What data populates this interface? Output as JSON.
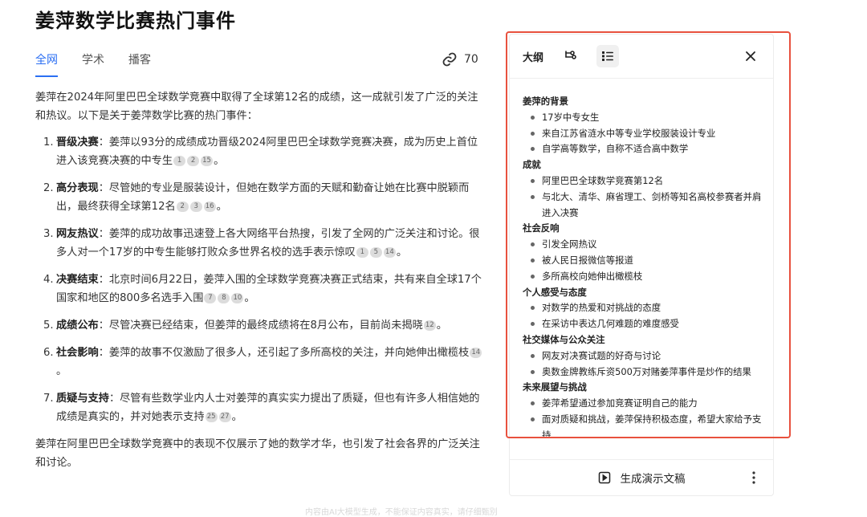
{
  "page": {
    "title": "姜萍数学比赛热门事件"
  },
  "tabs": [
    {
      "label": "全网",
      "active": true
    },
    {
      "label": "学术",
      "active": false
    },
    {
      "label": "播客",
      "active": false
    }
  ],
  "link_count": "70",
  "intro": "姜萍在2024年阿里巴巴全球数学竞赛中取得了全球第12名的成绩，这一成就引发了广泛的关注和热议。以下是关于姜萍数学比赛的热门事件：",
  "events": [
    {
      "num": "1.",
      "title": "晋级决赛",
      "text": "：姜萍以93分的成绩成功晋级2024阿里巴巴全球数学竞赛决赛，成为历史上首位进入该竞赛决赛的中专生",
      "cites": [
        "1",
        "2",
        "15"
      ],
      "end": "。"
    },
    {
      "num": "2.",
      "title": "高分表现",
      "text": "：尽管她的专业是服装设计，但她在数学方面的天赋和勤奋让她在比赛中脱颖而出，最终获得全球第12名",
      "cites": [
        "2",
        "3",
        "16"
      ],
      "end": "。"
    },
    {
      "num": "3.",
      "title": "网友热议",
      "text": "：姜萍的成功故事迅速登上各大网络平台热搜，引发了全网的广泛关注和讨论。很多人对一个17岁的中专生能够打败众多世界名校的选手表示惊叹",
      "cites": [
        "1",
        "5",
        "14"
      ],
      "end": "。"
    },
    {
      "num": "4.",
      "title": "决赛结束",
      "text": "：北京时间6月22日，姜萍入围的全球数学竞赛决赛正式结束，共有来自全球17个国家和地区的800多名选手入围",
      "cites": [
        "7",
        "8",
        "10"
      ],
      "end": "。"
    },
    {
      "num": "5.",
      "title": "成绩公布",
      "text": "：尽管决赛已经结束，但姜萍的最终成绩将在8月公布，目前尚未揭晓",
      "cites": [
        "12"
      ],
      "end": "。"
    },
    {
      "num": "6.",
      "title": "社会影响",
      "text": "：姜萍的故事不仅激励了很多人，还引起了多所高校的关注，并向她伸出橄榄枝",
      "cites": [
        "14"
      ],
      "end": "。"
    },
    {
      "num": "7.",
      "title": "质疑与支持",
      "text": "：尽管有些数学业内人士对姜萍的真实实力提出了质疑，但也有许多人相信她的成绩是真实的，并对她表示支持",
      "cites": [
        "25",
        "27"
      ],
      "end": "。"
    }
  ],
  "conclusion": "姜萍在阿里巴巴全球数学竞赛中的表现不仅展示了她的数学才华，也引发了社会各界的广泛关注和讨论。",
  "outline": {
    "header_label": "大纲",
    "sections": [
      {
        "title": "姜萍的背景",
        "items": [
          "17岁中专女生",
          "来自江苏省涟水中等专业学校服装设计专业",
          "自学高等数学，自称不适合高中数学"
        ]
      },
      {
        "title": "成就",
        "items": [
          "阿里巴巴全球数学竞赛第12名",
          "与北大、清华、麻省理工、剑桥等知名高校参赛者并肩进入决赛"
        ]
      },
      {
        "title": "社会反响",
        "items": [
          "引发全网热议",
          "被人民日报微信等报道",
          "多所高校向她伸出橄榄枝"
        ]
      },
      {
        "title": "个人感受与态度",
        "items": [
          "对数学的热爱和对挑战的态度",
          "在采访中表达几何难题的难度感受"
        ]
      },
      {
        "title": "社交媒体与公众关注",
        "items": [
          "网友对决赛试题的好奇与讨论",
          "奥数金牌教练斥资500万对赌姜萍事件是炒作的结果"
        ]
      },
      {
        "title": "未来展望与挑战",
        "items": [
          "姜萍希望通过参加竞赛证明自己的能力",
          "面对质疑和挑战，姜萍保持积极态度，希望大家给予支持"
        ]
      }
    ],
    "generate_label": "生成演示文稿"
  },
  "disclaimer": "内容由AI大模型生成，不能保证内容真实，请仔细甄别",
  "colors": {
    "accent": "#2b6ff3",
    "highlight_frame": "#e8513e"
  }
}
